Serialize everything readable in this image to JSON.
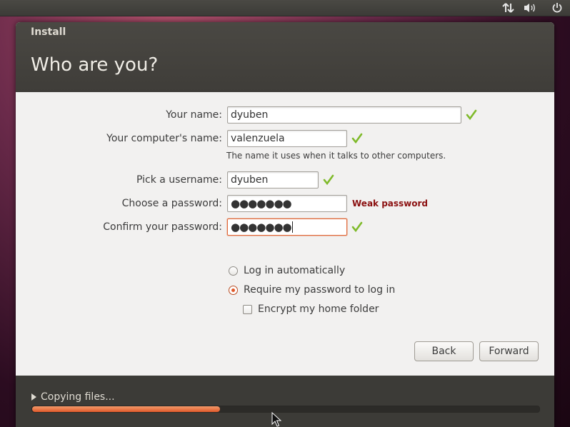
{
  "window": {
    "title": "Install",
    "page_title": "Who are you?"
  },
  "form": {
    "name_label": "Your name:",
    "name_value": "dyuben",
    "computer_label": "Your computer's name:",
    "computer_value": "valenzuela",
    "computer_hint": "The name it uses when it talks to other computers.",
    "username_label": "Pick a username:",
    "username_value": "dyuben",
    "password_label": "Choose a password:",
    "password_value": "●●●●●●●",
    "password_strength": "Weak password",
    "confirm_label": "Confirm your password:",
    "confirm_value": "●●●●●●●",
    "login_auto_label": "Log in automatically",
    "require_password_label": "Require my password to log in",
    "encrypt_label": "Encrypt my home folder",
    "login_mode_selected": "require_password",
    "encrypt_checked": false
  },
  "buttons": {
    "back": "Back",
    "forward": "Forward"
  },
  "footer": {
    "status": "Copying files...",
    "progress": 0.37
  },
  "icons": {
    "network": "network-transfer-icon",
    "volume": "volume-icon",
    "power": "power-icon",
    "valid": "checkmark-icon"
  },
  "colors": {
    "accent": "#e0592a",
    "weak": "#8b1010",
    "valid": "#7fba2a"
  }
}
